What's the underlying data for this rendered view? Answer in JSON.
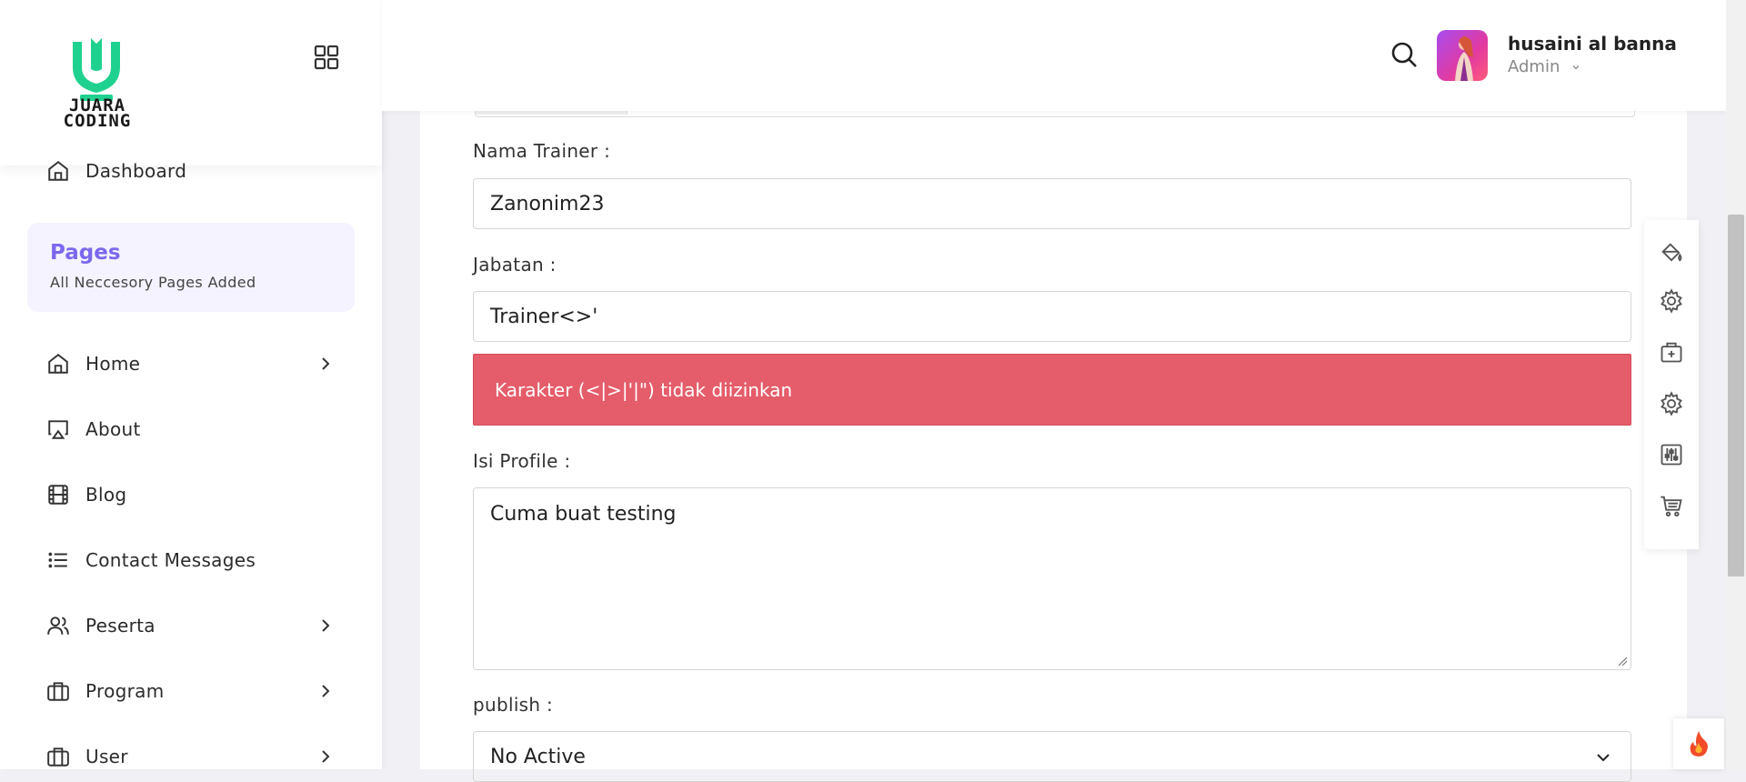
{
  "brand": {
    "logo_text_line1": "JUARA",
    "logo_text_line2": "CODING",
    "logo_icon": "shield-v-icon",
    "accent_color": "#1fd18f"
  },
  "sidebar": {
    "top_item": {
      "label": "Dashboard",
      "icon": "home-icon"
    },
    "pages_card": {
      "title": "Pages",
      "subtitle": "All Neccesory Pages Added"
    },
    "items": [
      {
        "label": "Home",
        "icon": "home-icon",
        "has_chevron": true
      },
      {
        "label": "About",
        "icon": "airplay-icon",
        "has_chevron": false
      },
      {
        "label": "Blog",
        "icon": "film-icon",
        "has_chevron": false
      },
      {
        "label": "Contact Messages",
        "icon": "list-icon",
        "has_chevron": false
      },
      {
        "label": "Peserta",
        "icon": "users-icon",
        "has_chevron": true
      },
      {
        "label": "Program",
        "icon": "briefcase-icon",
        "has_chevron": true
      },
      {
        "label": "User",
        "icon": "briefcase-icon",
        "has_chevron": true
      }
    ]
  },
  "header": {
    "user_name": "husaini al banna",
    "user_role": "Admin"
  },
  "form": {
    "nama_trainer_label": "Nama Trainer :",
    "nama_trainer_value": "Zanonim23",
    "jabatan_label": "Jabatan :",
    "jabatan_value": "Trainer<>'",
    "alert_text": "Karakter (<|>|'|\") tidak diizinkan",
    "isi_profile_label": "Isi Profile :",
    "isi_profile_value": "Cuma buat testing",
    "publish_label": "publish :",
    "publish_value": "No Active"
  },
  "right_toolbar": {
    "icons": [
      "paint-bucket-icon",
      "settings-icon",
      "medical-bag-icon",
      "settings-icon",
      "sliders-icon",
      "cart-icon"
    ]
  },
  "colors": {
    "alert_bg": "#e55c6a",
    "pages_title": "#7b68ee",
    "pages_bg": "#f5f3ff"
  }
}
